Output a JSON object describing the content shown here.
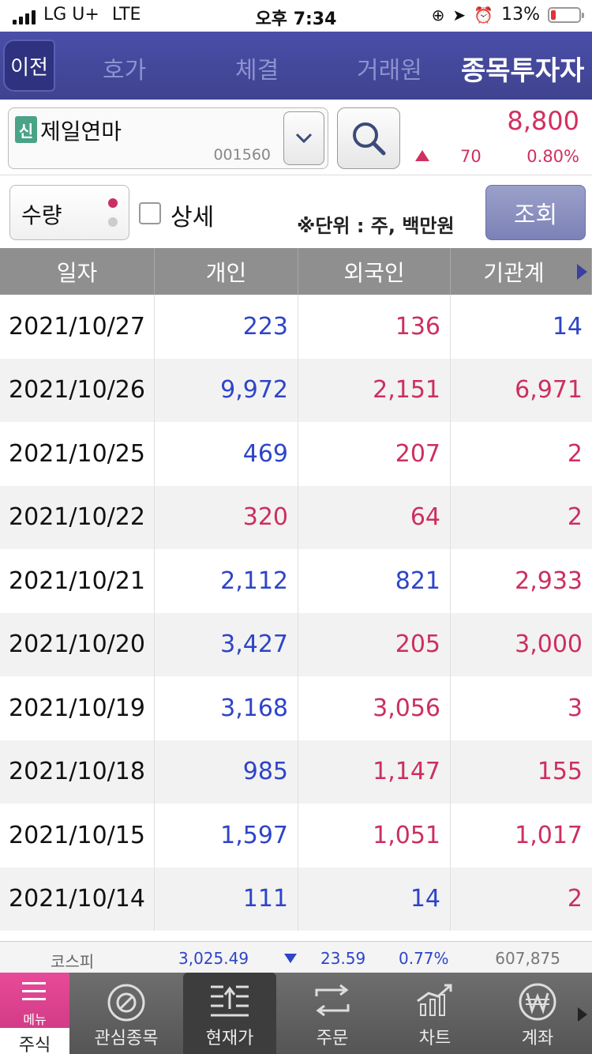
{
  "status": {
    "carrier": "LG U+",
    "network": "LTE",
    "time": "오후 7:34",
    "battery": "13%"
  },
  "tabs": {
    "back": "이전",
    "items": [
      "호가",
      "체결",
      "거래원",
      "종목투자자"
    ],
    "active_index": 3
  },
  "stock": {
    "badge": "신",
    "name": "제일연마",
    "code": "001560",
    "price": "8,800",
    "change": "70",
    "change_pct": "0.80%",
    "direction": "up"
  },
  "options": {
    "mode_label": "수량",
    "detail_label": "상세",
    "unit_text": "※단위 : 주, 백만원",
    "query_label": "조회"
  },
  "table": {
    "headers": [
      "일자",
      "개인",
      "외국인",
      "기관계"
    ],
    "rows": [
      {
        "date": "2021/10/27",
        "individual": "223",
        "foreign": "136",
        "institution": "14",
        "colors": [
          "blue",
          "red",
          "blue"
        ]
      },
      {
        "date": "2021/10/26",
        "individual": "9,972",
        "foreign": "2,151",
        "institution": "6,971",
        "colors": [
          "blue",
          "red",
          "red"
        ]
      },
      {
        "date": "2021/10/25",
        "individual": "469",
        "foreign": "207",
        "institution": "2",
        "colors": [
          "blue",
          "red",
          "red"
        ]
      },
      {
        "date": "2021/10/22",
        "individual": "320",
        "foreign": "64",
        "institution": "2",
        "colors": [
          "red",
          "red",
          "red"
        ]
      },
      {
        "date": "2021/10/21",
        "individual": "2,112",
        "foreign": "821",
        "institution": "2,933",
        "colors": [
          "blue",
          "blue",
          "red"
        ]
      },
      {
        "date": "2021/10/20",
        "individual": "3,427",
        "foreign": "205",
        "institution": "3,000",
        "colors": [
          "blue",
          "red",
          "red"
        ]
      },
      {
        "date": "2021/10/19",
        "individual": "3,168",
        "foreign": "3,056",
        "institution": "3",
        "colors": [
          "blue",
          "red",
          "red"
        ]
      },
      {
        "date": "2021/10/18",
        "individual": "985",
        "foreign": "1,147",
        "institution": "155",
        "colors": [
          "blue",
          "red",
          "red"
        ]
      },
      {
        "date": "2021/10/15",
        "individual": "1,597",
        "foreign": "1,051",
        "institution": "1,017",
        "colors": [
          "blue",
          "red",
          "red"
        ]
      },
      {
        "date": "2021/10/14",
        "individual": "111",
        "foreign": "14",
        "institution": "2",
        "colors": [
          "blue",
          "blue",
          "red"
        ]
      }
    ]
  },
  "market": {
    "name": "코스피",
    "value": "3,025.49",
    "change": "23.59",
    "change_pct": "0.77%",
    "volume": "607,875",
    "direction": "down"
  },
  "bottom_nav": {
    "menu_label": "메뉴",
    "stock_label": "주식",
    "items": [
      "관심종목",
      "현재가",
      "주문",
      "차트",
      "계좌"
    ],
    "active_index": 1
  },
  "colors": {
    "up": "#cc2f5f",
    "down": "#2e44c8",
    "tab_bg": "#4a4ea8",
    "menu_pink": "#e84a98"
  }
}
